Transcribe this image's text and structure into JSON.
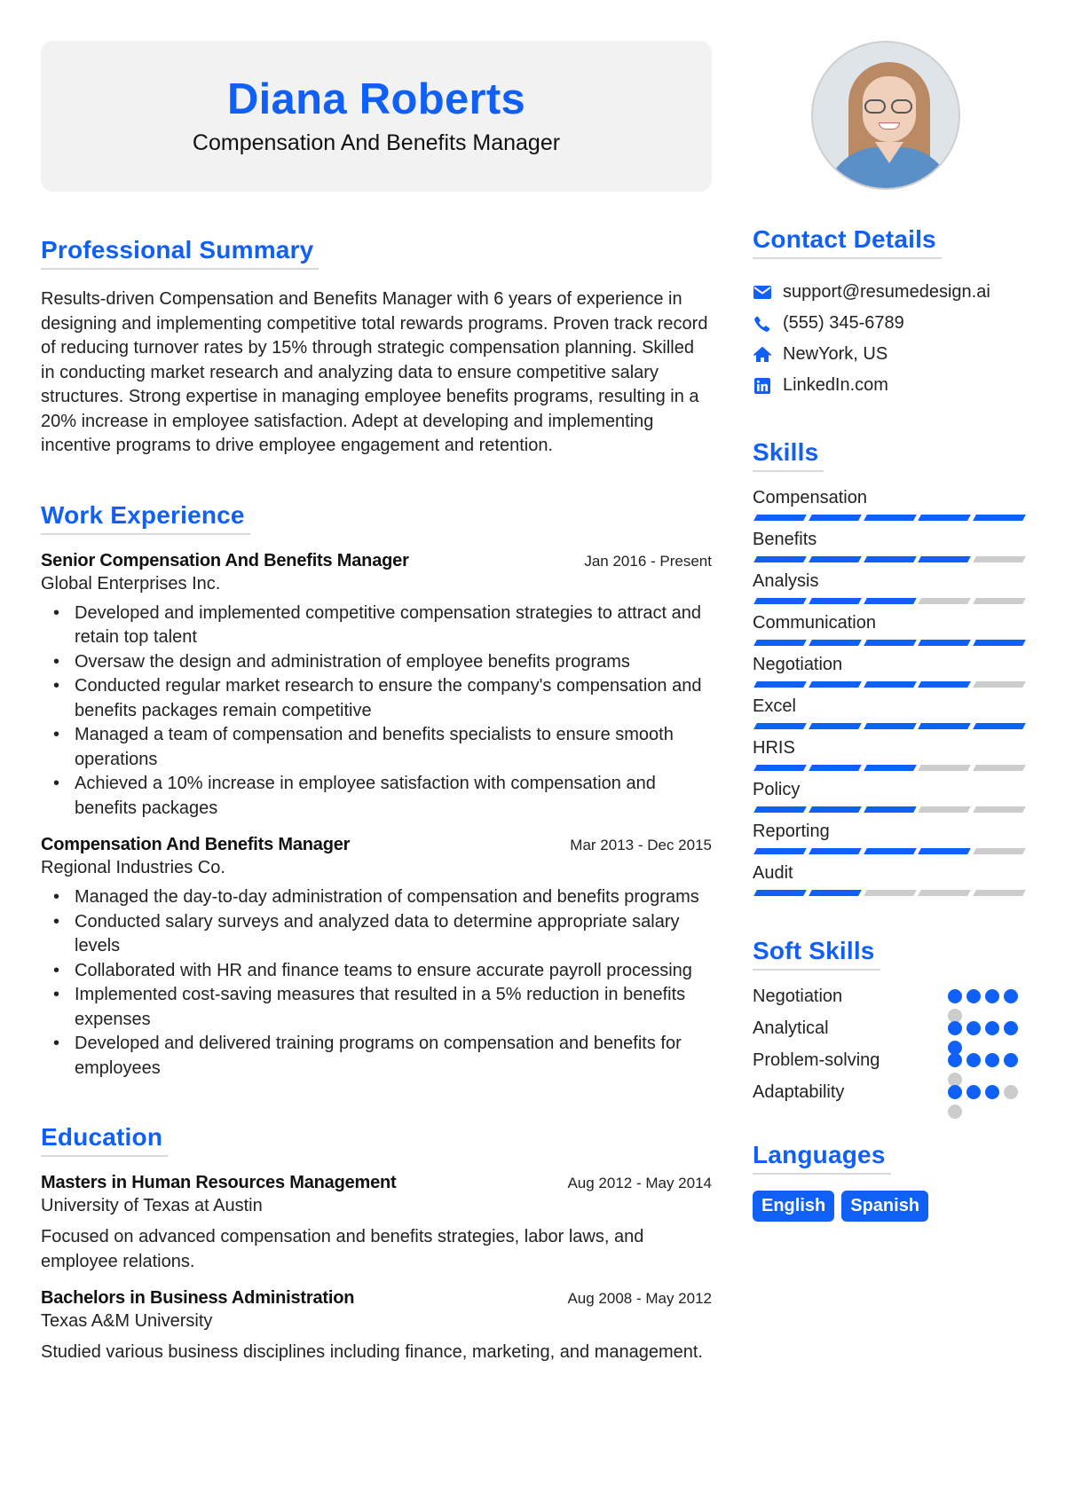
{
  "header": {
    "name": "Diana Roberts",
    "title": "Compensation And Benefits Manager"
  },
  "avatar": {
    "alt": "profile-photo"
  },
  "summary": {
    "heading": "Professional Summary",
    "text": "Results-driven Compensation and Benefits Manager with 6 years of experience in designing and implementing competitive total rewards programs. Proven track record of reducing turnover rates by 15% through strategic compensation planning. Skilled in conducting market research and analyzing data to ensure competitive salary structures. Strong expertise in managing employee benefits programs, resulting in a 20% increase in employee satisfaction. Adept at developing and implementing incentive programs to drive employee engagement and retention."
  },
  "experience": {
    "heading": "Work Experience",
    "jobs": [
      {
        "title": "Senior Compensation And Benefits Manager",
        "date": "Jan 2016 - Present",
        "company": "Global Enterprises Inc.",
        "bullets": [
          "Developed and implemented competitive compensation strategies to attract and retain top talent",
          "Oversaw the design and administration of employee benefits programs",
          "Conducted regular market research to ensure the company's compensation and benefits packages remain competitive",
          "Managed a team of compensation and benefits specialists to ensure smooth operations",
          "Achieved a 10% increase in employee satisfaction with compensation and benefits packages"
        ]
      },
      {
        "title": "Compensation And Benefits Manager",
        "date": "Mar 2013 - Dec 2015",
        "company": "Regional Industries Co.",
        "bullets": [
          "Managed the day-to-day administration of compensation and benefits programs",
          "Conducted salary surveys and analyzed data to determine appropriate salary levels",
          "Collaborated with HR and finance teams to ensure accurate payroll processing",
          "Implemented cost-saving measures that resulted in a 5% reduction in benefits expenses",
          "Developed and delivered training programs on compensation and benefits for employees"
        ]
      }
    ]
  },
  "education": {
    "heading": "Education",
    "items": [
      {
        "degree": "Masters in Human Resources Management",
        "date": "Aug 2012 - May 2014",
        "school": "University of Texas at Austin",
        "desc": "Focused on advanced compensation and benefits strategies, labor laws, and employee relations."
      },
      {
        "degree": "Bachelors in Business Administration",
        "date": "Aug 2008 - May 2012",
        "school": "Texas A&M University",
        "desc": "Studied various business disciplines including finance, marketing, and management."
      }
    ]
  },
  "contact": {
    "heading": "Contact Details",
    "items": [
      {
        "icon": "envelope-icon",
        "text": "support@resumedesign.ai"
      },
      {
        "icon": "phone-icon",
        "text": "(555) 345-6789"
      },
      {
        "icon": "home-icon",
        "text": "NewYork, US"
      },
      {
        "icon": "linkedin-icon",
        "text": "LinkedIn.com"
      }
    ]
  },
  "skills": {
    "heading": "Skills",
    "max": 5,
    "items": [
      {
        "name": "Compensation",
        "level": 5
      },
      {
        "name": "Benefits",
        "level": 4
      },
      {
        "name": "Analysis",
        "level": 3
      },
      {
        "name": "Communication",
        "level": 5
      },
      {
        "name": "Negotiation",
        "level": 4
      },
      {
        "name": "Excel",
        "level": 5
      },
      {
        "name": "HRIS",
        "level": 3
      },
      {
        "name": "Policy",
        "level": 3
      },
      {
        "name": "Reporting",
        "level": 4
      },
      {
        "name": "Audit",
        "level": 2
      }
    ]
  },
  "soft_skills": {
    "heading": "Soft Skills",
    "max": 5,
    "items": [
      {
        "name": "Negotiation",
        "level": 4
      },
      {
        "name": "Analytical",
        "level": 5
      },
      {
        "name": "Problem-solving",
        "level": 4
      },
      {
        "name": "Adaptability",
        "level": 3
      }
    ]
  },
  "languages": {
    "heading": "Languages",
    "items": [
      "English",
      "Spanish"
    ]
  },
  "colors": {
    "accent": "#1160f5",
    "inactive": "#cccccc",
    "header_bg": "#f2f2f2"
  }
}
